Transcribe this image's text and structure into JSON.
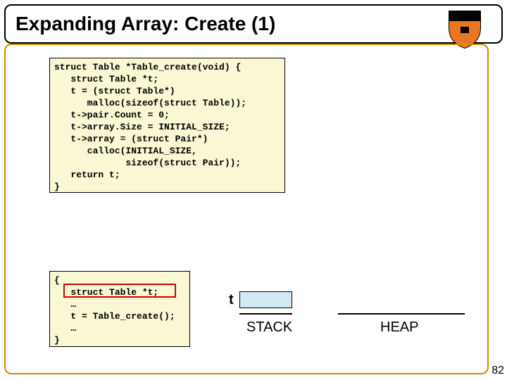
{
  "title": "Expanding Array: Create (1)",
  "code1": {
    "l0": "struct Table *Table_create(void) {",
    "l1": "   struct Table *t;",
    "l2": "   t = (struct Table*)",
    "l3": "      malloc(sizeof(struct Table));",
    "l4": "   t->pair.Count = 0;",
    "l5": "   t->array.Size = INITIAL_SIZE;",
    "l6": "   t->array = (struct Pair*)",
    "l7": "      calloc(INITIAL_SIZE,",
    "l8": "             sizeof(struct Pair));",
    "l9": "   return t;",
    "l10": "}"
  },
  "code2": {
    "l0": "{",
    "l1": "   struct Table *t;",
    "l2": "   …",
    "l3": "   t = Table_create();",
    "l4": "   …",
    "l5": "}"
  },
  "diagram": {
    "t_label": "t",
    "stack_label": "STACK",
    "heap_label": "HEAP"
  },
  "page_number": "82"
}
